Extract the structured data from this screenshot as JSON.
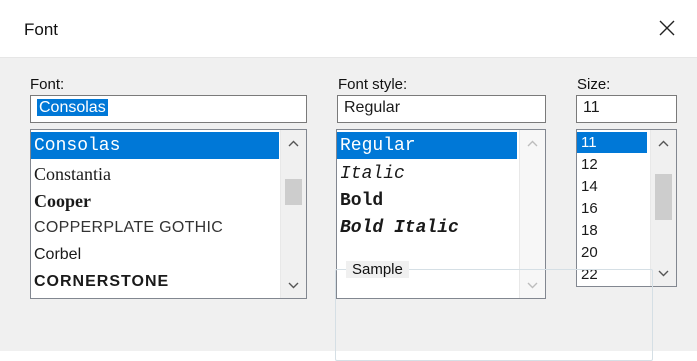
{
  "window": {
    "title": "Font",
    "close_icon": "close-icon"
  },
  "font": {
    "label": "Font:",
    "input_value": "Consolas",
    "items": [
      {
        "label": "Consolas",
        "selected": true
      },
      {
        "label": "Constantia",
        "selected": false
      },
      {
        "label": "Cooper",
        "selected": false
      },
      {
        "label": "COPPERPLATE GOTHIC",
        "selected": false
      },
      {
        "label": "Corbel",
        "selected": false
      },
      {
        "label": "CORNERSTONE",
        "selected": false
      }
    ]
  },
  "style": {
    "label": "Font style:",
    "input_value": "Regular",
    "items": [
      {
        "label": "Regular",
        "selected": true
      },
      {
        "label": "Italic",
        "selected": false
      },
      {
        "label": "Bold",
        "selected": false
      },
      {
        "label": "Bold Italic",
        "selected": false
      }
    ]
  },
  "size": {
    "label": "Size:",
    "input_value": "11",
    "items": [
      {
        "label": "11",
        "selected": true
      },
      {
        "label": "12",
        "selected": false
      },
      {
        "label": "14",
        "selected": false
      },
      {
        "label": "16",
        "selected": false
      },
      {
        "label": "18",
        "selected": false
      },
      {
        "label": "20",
        "selected": false
      },
      {
        "label": "22",
        "selected": false
      }
    ]
  },
  "sample": {
    "label": "Sample"
  },
  "colors": {
    "selection": "#0078d7",
    "dialog_bg": "#f0f0f0"
  }
}
